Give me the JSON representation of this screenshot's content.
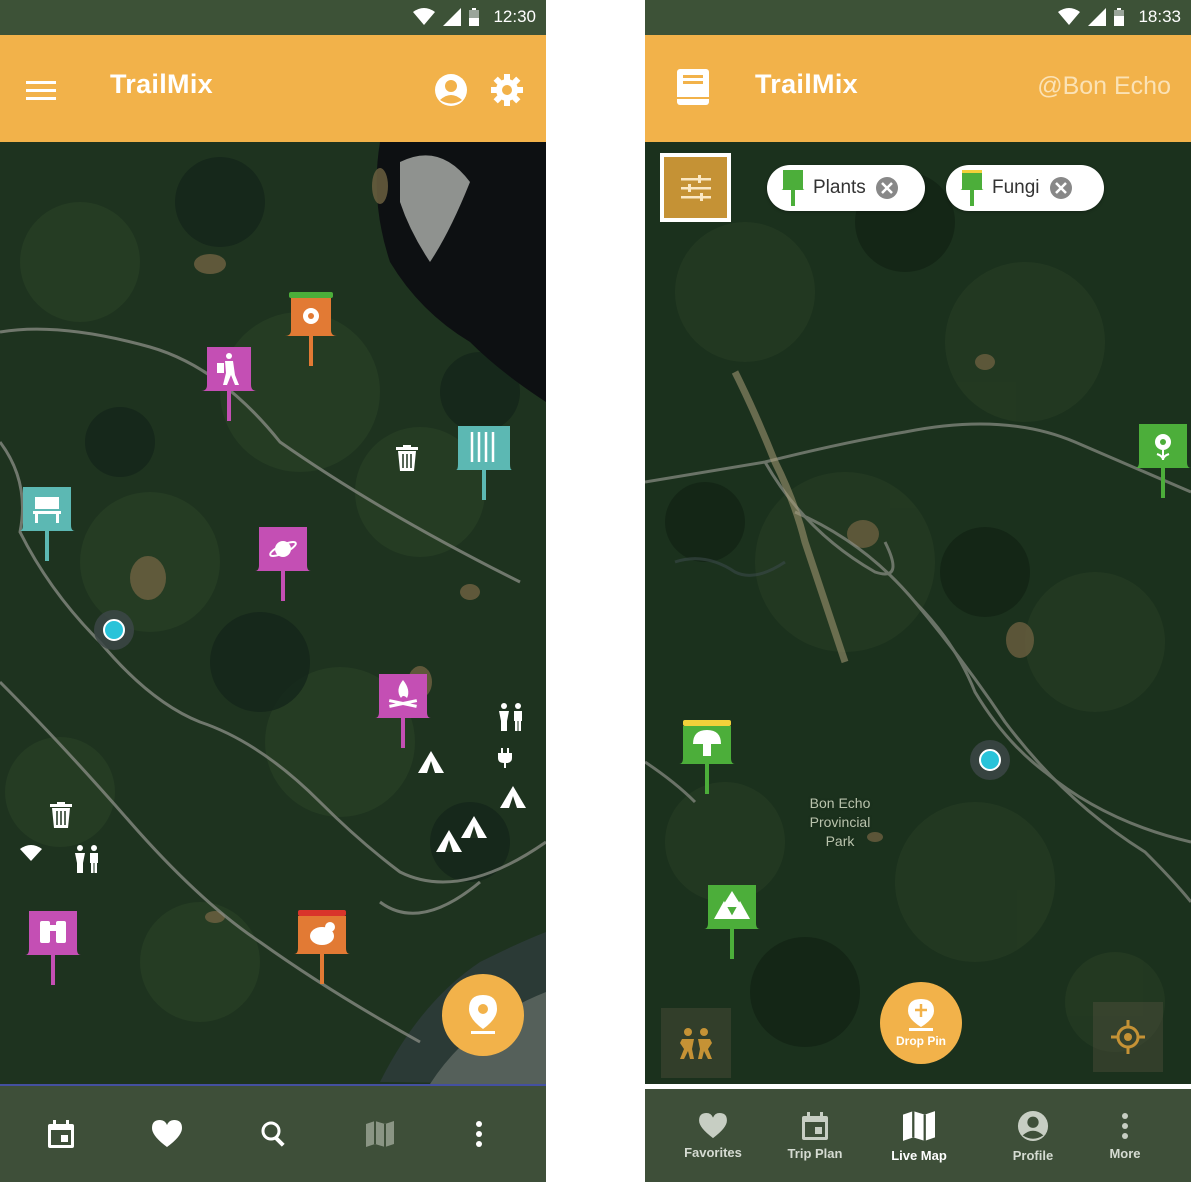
{
  "left": {
    "status": {
      "time": "12:30"
    },
    "appbar": {
      "title": "TrailMix"
    },
    "colors": {
      "appbar": "#f2b24a",
      "status": "#3d5237",
      "nav": "#3e4f39",
      "pin_magenta": "#c44fb4",
      "pin_teal": "#5cb8b3",
      "pin_orange": "#e27a34"
    },
    "pins": [
      {
        "name": "pin-flower",
        "color": "#e27a34",
        "band": "#4cae3a",
        "icon": "flower-icon"
      },
      {
        "name": "pin-hiker",
        "color": "#c44fb4",
        "icon": "hiker-icon"
      },
      {
        "name": "pin-waterfall",
        "color": "#5cb8b3",
        "icon": "waterfall-icon"
      },
      {
        "name": "pin-bench",
        "color": "#5cb8b3",
        "icon": "bench-icon"
      },
      {
        "name": "pin-planet",
        "color": "#c44fb4",
        "icon": "planet-icon"
      },
      {
        "name": "pin-campfire",
        "color": "#c44fb4",
        "icon": "campfire-icon"
      },
      {
        "name": "pin-binoculars",
        "color": "#c44fb4",
        "icon": "binoculars-icon"
      },
      {
        "name": "pin-animal",
        "color": "#e27a34",
        "band": "#d9342b",
        "icon": "beaver-icon"
      }
    ],
    "bottom_nav": [
      "calendar-icon",
      "heart-icon",
      "search-icon",
      "map-icon",
      "more-vert-icon"
    ]
  },
  "right": {
    "status": {
      "time": "18:33"
    },
    "appbar": {
      "title": "TrailMix",
      "location": "@Bon Echo"
    },
    "chips": [
      {
        "label": "Plants",
        "pin_color": "#4cae3a",
        "band": "#4cae3a"
      },
      {
        "label": "Fungi",
        "pin_color": "#4cae3a",
        "band": "#f2d13a"
      }
    ],
    "pins": [
      {
        "name": "pin-plant-flower",
        "color": "#4cae3a",
        "icon": "flower-icon"
      },
      {
        "name": "pin-mushroom",
        "color": "#4cae3a",
        "band": "#f2d13a",
        "icon": "mushroom-icon"
      },
      {
        "name": "pin-trees",
        "color": "#4cae3a",
        "icon": "trees-icon"
      }
    ],
    "map_label": [
      "Bon Echo",
      "Provincial",
      "Park"
    ],
    "fab": {
      "label": "Drop Pin"
    },
    "bottom_nav": [
      {
        "label": "Favorites",
        "icon": "heart-icon"
      },
      {
        "label": "Trip Plan",
        "icon": "calendar-icon"
      },
      {
        "label": "Live Map",
        "icon": "map-icon"
      },
      {
        "label": "Profile",
        "icon": "profile-icon"
      },
      {
        "label": "More",
        "icon": "more-vert-icon"
      }
    ]
  }
}
